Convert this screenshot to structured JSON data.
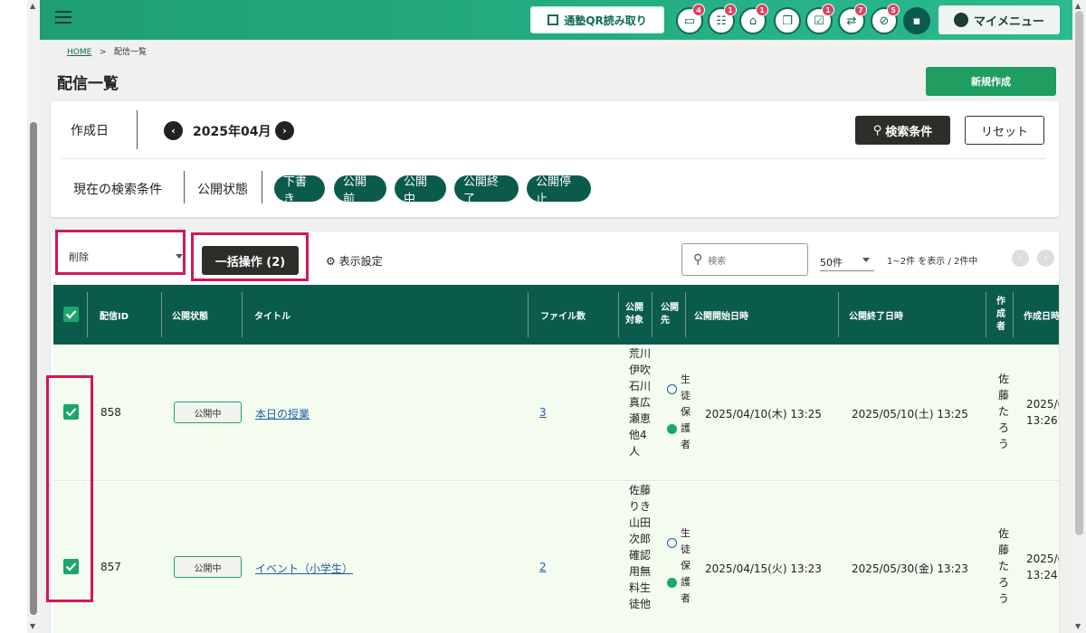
{
  "header": {
    "qr_label": "通塾QR読み取り",
    "icons": [
      {
        "name": "message",
        "badge": "4"
      },
      {
        "name": "group",
        "badge": "1"
      },
      {
        "name": "school",
        "badge": "1"
      },
      {
        "name": "gift",
        "badge": ""
      },
      {
        "name": "checklist",
        "badge": "1"
      },
      {
        "name": "swap",
        "badge": "7"
      },
      {
        "name": "block",
        "badge": "5"
      },
      {
        "name": "chat",
        "badge": ""
      }
    ],
    "my_menu": "マイメニュー"
  },
  "breadcrumb": {
    "home": "HOME",
    "sep": ">",
    "current": "配信一覧"
  },
  "page_title": "配信一覧",
  "new_button": "新規作成",
  "search_panel": {
    "date_label": "作成日",
    "month": "2025年04月",
    "search_button": "検索条件",
    "reset_button": "リセット",
    "current_conditions": "現在の検索条件",
    "status_label": "公開状態",
    "chips": [
      "下書き",
      "公開前",
      "公開中",
      "公開終了",
      "公開停止"
    ]
  },
  "list": {
    "bulk_select_value": "削除",
    "bulk_button": "一括操作 (2)",
    "display_settings": "表示設定",
    "search_placeholder": "検索",
    "per_page": "50件",
    "range_text": "1~2件 を表示 / 2件中",
    "columns": {
      "id": "配信ID",
      "status": "公開状態",
      "title": "タイトル",
      "files": "ファイル数",
      "target": "公開対象",
      "dest": "公開先",
      "start": "公開開始日時",
      "end": "公開終了日時",
      "author": "作成者",
      "created": "作成日時"
    },
    "rows": [
      {
        "id": "858",
        "status": "公開中",
        "title": "本日の授業",
        "files": "3",
        "target": "荒川伊吹石川真広瀬恵他4人",
        "dest_student": "生徒",
        "dest_parent": "保護者",
        "start": "2025/04/10(木) 13:25",
        "end": "2025/05/10(土) 13:25",
        "author": "佐藤たろう",
        "created_date": "2025/0",
        "created_time": "13:26"
      },
      {
        "id": "857",
        "status": "公開中",
        "title": "イベント（小学生）",
        "files": "2",
        "target": "佐藤りき山田次郎確認用無料生徒他",
        "dest_student": "生徒",
        "dest_parent": "保護者",
        "start": "2025/04/15(火) 13:23",
        "end": "2025/05/30(金) 13:23",
        "author": "佐藤たろう",
        "created_date": "2025/0",
        "created_time": "13:24"
      }
    ]
  },
  "colors": {
    "header_green": "#22b28a",
    "table_header": "#0b5b4c",
    "primary_green": "#1e9e61",
    "highlight": "#d1175a",
    "row_bg": "#f4fbef"
  }
}
